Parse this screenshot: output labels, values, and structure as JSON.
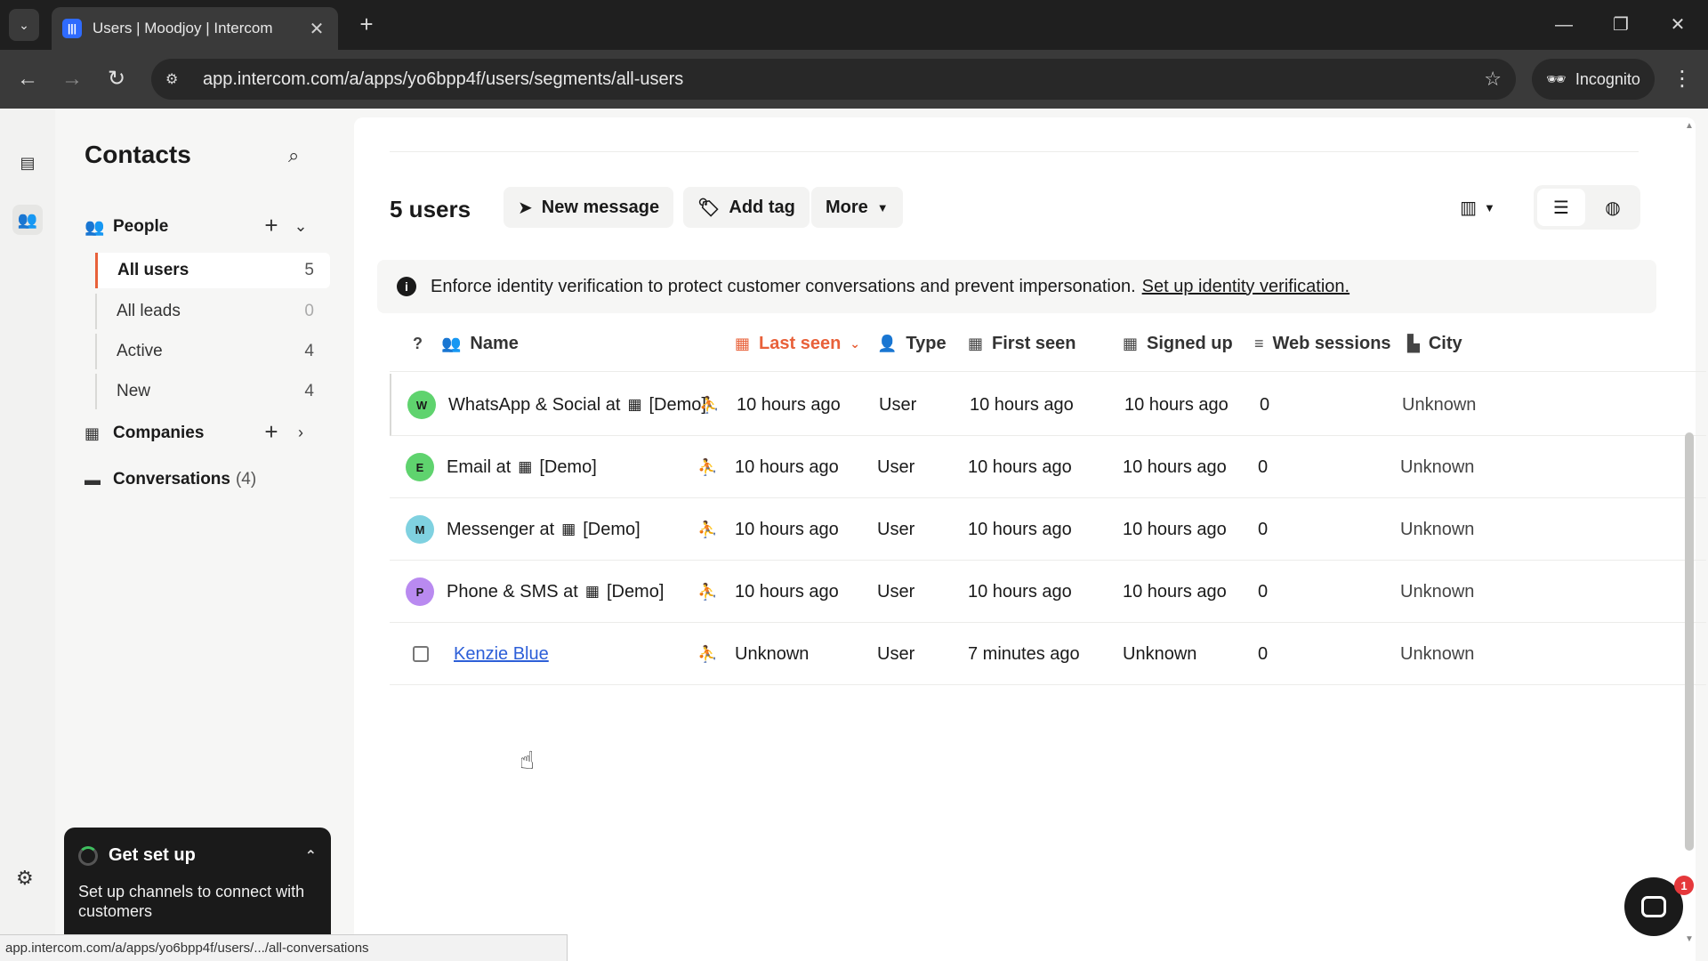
{
  "browser": {
    "tab_title": "Users | Moodjoy | Intercom",
    "url": "app.intercom.com/a/apps/yo6bpp4f/users/segments/all-users",
    "profile_label": "Incognito",
    "status_url": "app.intercom.com/a/apps/yo6bpp4f/users/.../all-conversations"
  },
  "sidebar": {
    "title": "Contacts",
    "people_label": "People",
    "segments": [
      {
        "label": "All users",
        "count": "5"
      },
      {
        "label": "All leads",
        "count": "0"
      },
      {
        "label": "Active",
        "count": "4"
      },
      {
        "label": "New",
        "count": "4"
      }
    ],
    "companies_label": "Companies",
    "conversations_label": "Conversations",
    "conversations_count": "(4)"
  },
  "setup": {
    "title": "Get set up",
    "text": "Set up channels to connect with customers"
  },
  "toolbar": {
    "count_label": "5 users",
    "new_message": "New message",
    "add_tag": "Add tag",
    "more": "More"
  },
  "banner": {
    "text": "Enforce identity verification to protect customer conversations and prevent impersonation.",
    "link": "Set up identity verification."
  },
  "table": {
    "columns": {
      "name": "Name",
      "last_seen": "Last seen",
      "type": "Type",
      "first_seen": "First seen",
      "signed_up": "Signed up",
      "web_sessions": "Web sessions",
      "city": "City"
    },
    "rows": [
      {
        "initial": "W",
        "avatar_color": "#5fd36e",
        "name": "WhatsApp & Social at",
        "company": "[Demo]",
        "last_seen": "10 hours ago",
        "type": "User",
        "first_seen": "10 hours ago",
        "signed_up": "10 hours ago",
        "web_sessions": "0",
        "city": "Unknown"
      },
      {
        "initial": "E",
        "avatar_color": "#5fd36e",
        "name": "Email at",
        "company": "[Demo]",
        "last_seen": "10 hours ago",
        "type": "User",
        "first_seen": "10 hours ago",
        "signed_up": "10 hours ago",
        "web_sessions": "0",
        "city": "Unknown"
      },
      {
        "initial": "M",
        "avatar_color": "#7fd1e0",
        "name": "Messenger at",
        "company": "[Demo]",
        "last_seen": "10 hours ago",
        "type": "User",
        "first_seen": "10 hours ago",
        "signed_up": "10 hours ago",
        "web_sessions": "0",
        "city": "Unknown"
      },
      {
        "initial": "P",
        "avatar_color": "#b98af0",
        "name": "Phone & SMS at",
        "company": "[Demo]",
        "last_seen": "10 hours ago",
        "type": "User",
        "first_seen": "10 hours ago",
        "signed_up": "10 hours ago",
        "web_sessions": "0",
        "city": "Unknown"
      },
      {
        "name": "Kenzie Blue",
        "last_seen": "Unknown",
        "type": "User",
        "first_seen": "7 minutes ago",
        "signed_up": "Unknown",
        "web_sessions": "0",
        "city": "Unknown"
      }
    ]
  },
  "messenger_badge": "1",
  "colors": {
    "accent": "#e8613a",
    "link": "#2d5fd8",
    "dark": "#1a1a1a"
  }
}
